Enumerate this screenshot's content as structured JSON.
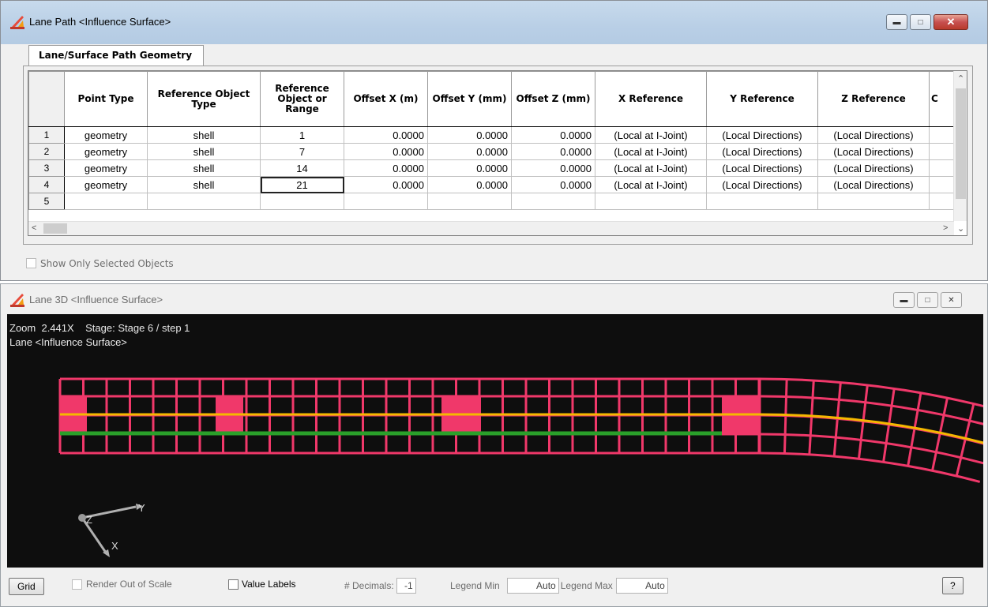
{
  "top_window": {
    "title": "Lane Path <Influence Surface>",
    "tab_label": "Lane/Surface Path Geometry",
    "columns": [
      "Point Type",
      "Reference Object Type",
      "Reference Object or Range",
      "Offset X (m)",
      "Offset Y (mm)",
      "Offset Z (mm)",
      "X Reference",
      "Y Reference",
      "Z Reference",
      "C"
    ],
    "rows": [
      {
        "n": "1",
        "point_type": "geometry",
        "ref_type": "shell",
        "ref_obj": "1",
        "ox": "0.0000",
        "oy": "0.0000",
        "oz": "0.0000",
        "xref": "(Local at I-Joint)",
        "yref": "(Local Directions)",
        "zref": "(Local Directions)"
      },
      {
        "n": "2",
        "point_type": "geometry",
        "ref_type": "shell",
        "ref_obj": "7",
        "ox": "0.0000",
        "oy": "0.0000",
        "oz": "0.0000",
        "xref": "(Local at I-Joint)",
        "yref": "(Local Directions)",
        "zref": "(Local Directions)"
      },
      {
        "n": "3",
        "point_type": "geometry",
        "ref_type": "shell",
        "ref_obj": "14",
        "ox": "0.0000",
        "oy": "0.0000",
        "oz": "0.0000",
        "xref": "(Local at I-Joint)",
        "yref": "(Local Directions)",
        "zref": "(Local Directions)"
      },
      {
        "n": "4",
        "point_type": "geometry",
        "ref_type": "shell",
        "ref_obj": "21",
        "ox": "0.0000",
        "oy": "0.0000",
        "oz": "0.0000",
        "xref": "(Local at I-Joint)",
        "yref": "(Local Directions)",
        "zref": "(Local Directions)"
      },
      {
        "n": "5",
        "point_type": "",
        "ref_type": "",
        "ref_obj": "",
        "ox": "",
        "oy": "",
        "oz": "",
        "xref": "",
        "yref": "",
        "zref": ""
      }
    ],
    "selected_cell": {
      "row": 4,
      "column": "Reference Object or Range"
    },
    "show_only_selected": {
      "label": "Show Only Selected Objects",
      "checked": false,
      "enabled": false
    },
    "caption_buttons": {
      "minimize": "minimize",
      "restore": "restore",
      "close": "close"
    }
  },
  "bottom_window": {
    "title": "Lane 3D <Influence Surface>",
    "viewport": {
      "zoom_label": "Zoom",
      "zoom_value": "2.441X",
      "stage_label": "Stage:",
      "stage_value": "Stage 6 / step 1",
      "lane_label": "Lane <Influence Surface>",
      "axis_labels": [
        "Y",
        "Z",
        "X"
      ],
      "mesh_color": "#f0386a",
      "path_color": "#f5b800",
      "lane_color": "#2aa02a"
    },
    "toolbar": {
      "grid_button": "Grid",
      "render_out_of_scale": "Render Out of Scale",
      "value_labels": "Value Labels",
      "decimals_label": "# Decimals:",
      "decimals_value": "-1",
      "legend_min_label": "Legend Min",
      "legend_min_value": "Auto",
      "legend_max_label": "Legend Max",
      "legend_max_value": "Auto",
      "help_button": "?"
    }
  }
}
